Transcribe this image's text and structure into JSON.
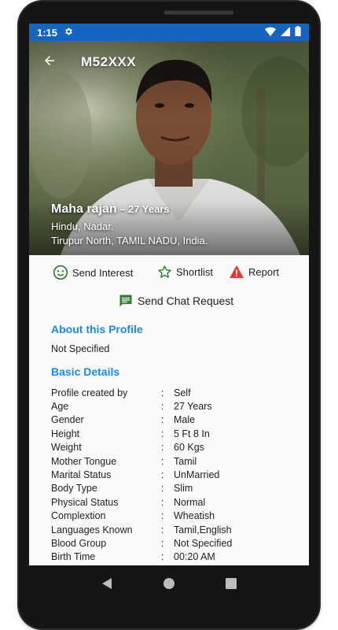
{
  "status_bar": {
    "time": "1:15",
    "icons": [
      "settings-icon",
      "wifi-icon",
      "signal-icon",
      "battery-icon"
    ],
    "color": "#1565c0"
  },
  "header": {
    "profile_id": "M52XXX",
    "back_icon": "arrow-back-icon"
  },
  "profile": {
    "name": "Maha rajan",
    "age": " – 27 Years",
    "religion_caste": "Hindu, Nadar.",
    "location": "Tirupur North, TAMIL NADU, India."
  },
  "actions": {
    "send_interest": "Send Interest",
    "shortlist": "Shortlist",
    "report": "Report",
    "send_chat_request": "Send Chat Request",
    "colors": {
      "interest": "#2e7d32",
      "shortlist": "#2e7d32",
      "report": "#e53935",
      "chat": "#2e7d32"
    }
  },
  "about": {
    "title": "About this Profile",
    "text": "Not Specified"
  },
  "basic_details": {
    "title": "Basic Details",
    "separator": ":",
    "rows": [
      {
        "label": "Profile created by",
        "value": "Self"
      },
      {
        "label": "Age",
        "value": "27 Years"
      },
      {
        "label": "Gender",
        "value": "Male"
      },
      {
        "label": "Height",
        "value": "5 Ft 8 In"
      },
      {
        "label": "Weight",
        "value": "60 Kgs"
      },
      {
        "label": "Mother Tongue",
        "value": "Tamil"
      },
      {
        "label": "Marital Status",
        "value": "UnMarried"
      },
      {
        "label": "Body Type",
        "value": "Slim"
      },
      {
        "label": "Physical Status",
        "value": "Normal"
      },
      {
        "label": "Complextion",
        "value": "Wheatish"
      },
      {
        "label": "Languages Known",
        "value": "Tamil,English"
      },
      {
        "label": "Blood Group",
        "value": "Not Specified"
      },
      {
        "label": "Birth Time",
        "value": "00:20 AM"
      }
    ]
  },
  "accent_color": "#1e88e5",
  "navigation": [
    "back-triangle-icon",
    "home-circle-icon",
    "recents-square-icon"
  ]
}
